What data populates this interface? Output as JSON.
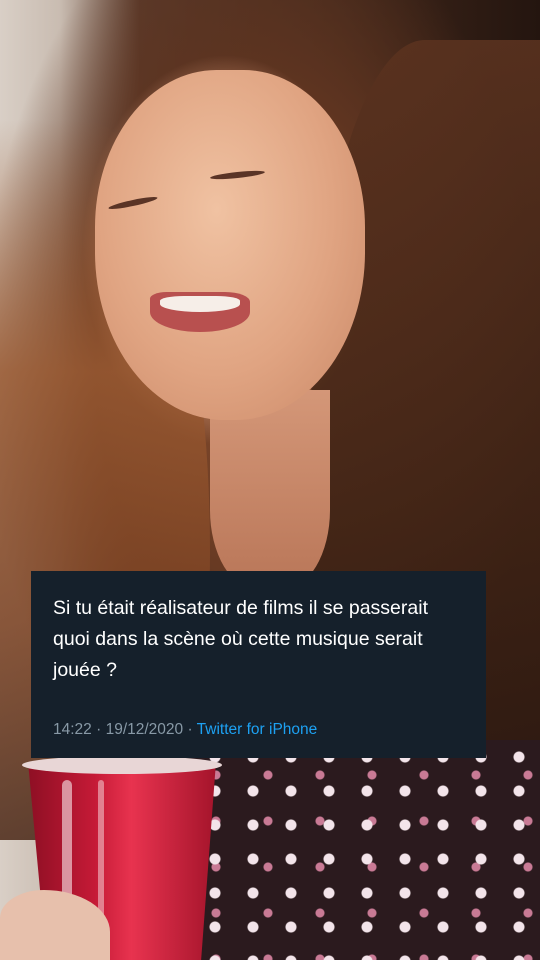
{
  "tweet": {
    "text": "Si tu était réalisateur de films il se passerait quoi dans la scène où cette musique serait jouée ?",
    "time": "14:22",
    "separator_1": " · ",
    "date": "19/12/2020",
    "separator_2": " · ",
    "source": "Twitter for iPhone"
  },
  "colors": {
    "card_background": "#15202b",
    "text": "#ffffff",
    "meta": "#8899a6",
    "link": "#1da1f2"
  }
}
